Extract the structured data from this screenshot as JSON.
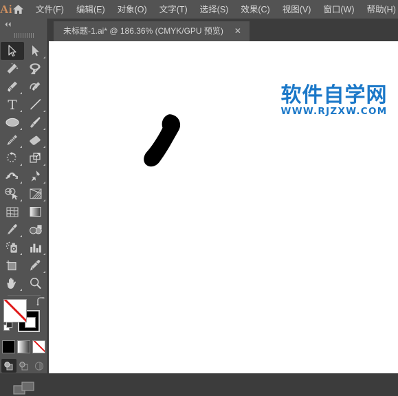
{
  "app": {
    "logo_text": "Ai",
    "home_icon": "home-icon"
  },
  "menubar": {
    "items": [
      {
        "label": "文件(F)"
      },
      {
        "label": "编辑(E)"
      },
      {
        "label": "对象(O)"
      },
      {
        "label": "文字(T)"
      },
      {
        "label": "选择(S)"
      },
      {
        "label": "效果(C)"
      },
      {
        "label": "视图(V)"
      },
      {
        "label": "窗口(W)"
      },
      {
        "label": "帮助(H)"
      }
    ]
  },
  "tabbar": {
    "document_tab": {
      "title": "未标题-1.ai* @ 186.36% (CMYK/GPU 预览)",
      "close_label": "✕",
      "zoom_level": "186.36%",
      "color_mode": "CMYK",
      "preview_mode": "GPU 预览",
      "filename": "未标题-1.ai",
      "modified": true
    }
  },
  "toolpanel": {
    "collapse_icon": "double-chevron-left-icon",
    "grip": "panel-grip",
    "tools": [
      {
        "name": "selection-tool",
        "active": true,
        "has_flyout": false
      },
      {
        "name": "direct-selection-tool",
        "active": false,
        "has_flyout": true
      },
      {
        "name": "magic-wand-tool",
        "active": false,
        "has_flyout": false
      },
      {
        "name": "lasso-tool",
        "active": false,
        "has_flyout": false
      },
      {
        "name": "pen-tool",
        "active": false,
        "has_flyout": true
      },
      {
        "name": "curvature-tool",
        "active": false,
        "has_flyout": false
      },
      {
        "name": "type-tool",
        "active": false,
        "has_flyout": true
      },
      {
        "name": "line-segment-tool",
        "active": false,
        "has_flyout": true
      },
      {
        "name": "ellipse-tool",
        "active": false,
        "has_flyout": true
      },
      {
        "name": "paintbrush-tool",
        "active": false,
        "has_flyout": true
      },
      {
        "name": "shaper-pencil-tool",
        "active": false,
        "has_flyout": true
      },
      {
        "name": "eraser-tool",
        "active": false,
        "has_flyout": true
      },
      {
        "name": "rotate-tool",
        "active": false,
        "has_flyout": true
      },
      {
        "name": "scale-tool",
        "active": false,
        "has_flyout": true
      },
      {
        "name": "width-warp-tool",
        "active": false,
        "has_flyout": true
      },
      {
        "name": "free-transform-tool",
        "active": false,
        "has_flyout": true
      },
      {
        "name": "shape-builder-tool",
        "active": false,
        "has_flyout": true
      },
      {
        "name": "perspective-grid-tool",
        "active": false,
        "has_flyout": true
      },
      {
        "name": "mesh-tool",
        "active": false,
        "has_flyout": false
      },
      {
        "name": "gradient-tool",
        "active": false,
        "has_flyout": false
      },
      {
        "name": "eyedropper-tool",
        "active": false,
        "has_flyout": true
      },
      {
        "name": "blend-tool",
        "active": false,
        "has_flyout": false
      },
      {
        "name": "symbol-sprayer-tool",
        "active": false,
        "has_flyout": true
      },
      {
        "name": "column-graph-tool",
        "active": false,
        "has_flyout": true
      },
      {
        "name": "artboard-tool",
        "active": false,
        "has_flyout": false
      },
      {
        "name": "slice-tool",
        "active": false,
        "has_flyout": true
      },
      {
        "name": "hand-tool",
        "active": false,
        "has_flyout": true
      },
      {
        "name": "zoom-tool",
        "active": false,
        "has_flyout": false
      }
    ],
    "fill_stroke": {
      "fill_label": "无",
      "fill_color": "none",
      "stroke_color": "#000000",
      "swap_icon": "swap-fill-stroke-icon",
      "default_icon": "default-fill-stroke-icon"
    },
    "color_modes": [
      {
        "name": "color-mode-button",
        "value": "#000000",
        "active": false
      },
      {
        "name": "gradient-mode-button",
        "value": "gradient",
        "active": false
      },
      {
        "name": "none-mode-button",
        "value": "none",
        "active": true
      }
    ],
    "draw_modes": [
      {
        "name": "draw-normal-button",
        "active": true
      },
      {
        "name": "draw-behind-button",
        "active": false
      },
      {
        "name": "draw-inside-button",
        "active": false
      }
    ],
    "screen_mode": {
      "name": "change-screen-mode-button"
    }
  },
  "canvas": {
    "artwork": {
      "name": "brush-stroke-artwork",
      "color": "#000000",
      "description": "黑色画笔笔触"
    },
    "background": "#ffffff"
  },
  "watermark": {
    "chinese": "软件自学网",
    "url": "WWW.RJZXW.COM",
    "color": "#1b78c8"
  }
}
